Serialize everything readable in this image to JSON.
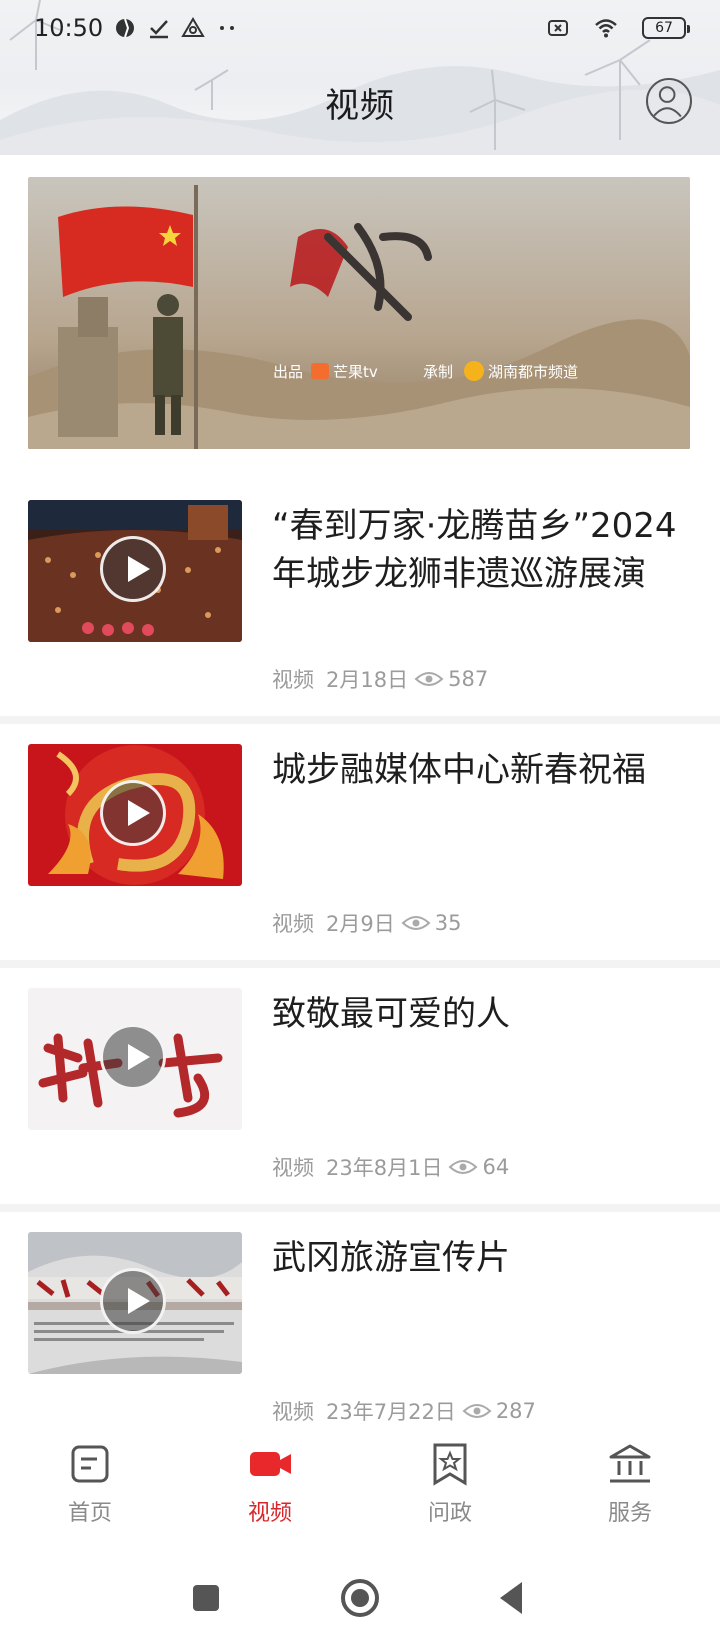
{
  "status_bar": {
    "time": "10:50",
    "battery": "67"
  },
  "header": {
    "title": "视频"
  },
  "videos": [
    {
      "title": "“春到万家·龙腾苗乡”2024年城步龙狮非遗巡游展演",
      "category": "视频",
      "date": "2月18日",
      "views": "587"
    },
    {
      "title": "城步融媒体中心新春祝福",
      "category": "视频",
      "date": "2月9日",
      "views": "35"
    },
    {
      "title": "致敬最可爱的人",
      "category": "视频",
      "date": "23年8月1日",
      "views": "64"
    },
    {
      "title": "武冈旅游宣传片",
      "category": "视频",
      "date": "23年7月22日",
      "views": "287"
    }
  ],
  "bottom_nav": [
    {
      "label": "首页",
      "icon": "home-news-icon",
      "active": false
    },
    {
      "label": "视频",
      "icon": "video-camera-icon",
      "active": true
    },
    {
      "label": "问政",
      "icon": "bookmark-star-icon",
      "active": false
    },
    {
      "label": "服务",
      "icon": "bank-building-icon",
      "active": false
    }
  ],
  "colors": {
    "accent": "#d8262a",
    "meta_text": "#9b9b9b",
    "nav_inactive": "#8a8a8a"
  }
}
